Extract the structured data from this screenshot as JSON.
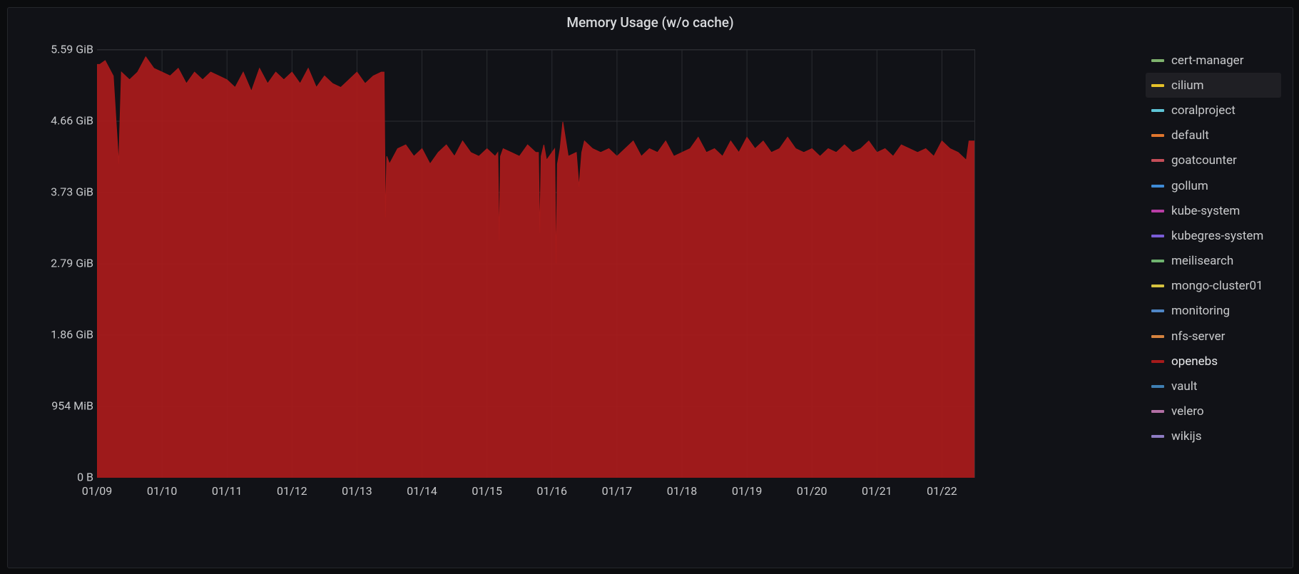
{
  "panel": {
    "title": "Memory Usage (w/o cache)"
  },
  "chart_data": {
    "type": "area",
    "title": "Memory Usage (w/o cache)",
    "xlabel": "",
    "ylabel": "",
    "x_ticks": [
      "01/09",
      "01/10",
      "01/11",
      "01/12",
      "01/13",
      "01/14",
      "01/15",
      "01/16",
      "01/17",
      "01/18",
      "01/19",
      "01/20",
      "01/21",
      "01/22"
    ],
    "y_ticks": [
      "0 B",
      "954 MiB",
      "1.86 GiB",
      "2.79 GiB",
      "3.73 GiB",
      "4.66 GiB",
      "5.59 GiB"
    ],
    "ylim_gib": [
      0,
      5.59
    ],
    "x": [
      "01/09 00",
      "01/09 01",
      "01/09 03",
      "01/09 06",
      "01/09 08",
      "01/09 09",
      "01/09 12",
      "01/09 15",
      "01/09 18",
      "01/09 21",
      "01/10 00",
      "01/10 03",
      "01/10 06",
      "01/10 09",
      "01/10 12",
      "01/10 15",
      "01/10 18",
      "01/10 21",
      "01/11 00",
      "01/11 03",
      "01/11 06",
      "01/11 09",
      "01/11 12",
      "01/11 15",
      "01/11 18",
      "01/11 21",
      "01/12 00",
      "01/12 03",
      "01/12 06",
      "01/12 09",
      "01/12 12",
      "01/12 15",
      "01/12 18",
      "01/12 21",
      "01/13 00",
      "01/13 03",
      "01/13 06",
      "01/13 09",
      "01/13 10",
      "01/13 10.5",
      "01/13 11",
      "01/13 12",
      "01/13 15",
      "01/13 18",
      "01/13 21",
      "01/14 00",
      "01/14 03",
      "01/14 06",
      "01/14 09",
      "01/14 12",
      "01/14 15",
      "01/14 18",
      "01/14 21",
      "01/15 00",
      "01/15 03",
      "01/15 04",
      "01/15 04.5",
      "01/15 05",
      "01/15 06",
      "01/15 09",
      "01/15 12",
      "01/15 15",
      "01/15 18",
      "01/15 19",
      "01/15 19.5",
      "01/15 20",
      "01/15 21",
      "01/15 22",
      "01/16 00",
      "01/16 01",
      "01/16 01.5",
      "01/16 02",
      "01/16 03",
      "01/16 04",
      "01/16 06",
      "01/16 09",
      "01/16 10",
      "01/16 11",
      "01/16 12",
      "01/16 15",
      "01/16 18",
      "01/16 21",
      "01/17 00",
      "01/17 03",
      "01/17 06",
      "01/17 09",
      "01/17 12",
      "01/17 15",
      "01/17 18",
      "01/17 21",
      "01/18 00",
      "01/18 03",
      "01/18 06",
      "01/18 09",
      "01/18 12",
      "01/18 15",
      "01/18 18",
      "01/18 21",
      "01/19 00",
      "01/19 03",
      "01/19 06",
      "01/19 09",
      "01/19 12",
      "01/19 15",
      "01/19 18",
      "01/19 21",
      "01/20 00",
      "01/20 03",
      "01/20 06",
      "01/20 09",
      "01/20 12",
      "01/20 15",
      "01/20 18",
      "01/20 21",
      "01/21 00",
      "01/21 03",
      "01/21 06",
      "01/21 09",
      "01/21 12",
      "01/21 15",
      "01/21 18",
      "01/21 21",
      "01/22 00",
      "01/22 03",
      "01/22 06",
      "01/22 09",
      "01/22 10",
      "01/22 12"
    ],
    "series": [
      {
        "name": "openebs",
        "color": "#a61b1b",
        "values_gib": [
          5.4,
          5.4,
          5.45,
          5.25,
          4.1,
          5.3,
          5.2,
          5.3,
          5.5,
          5.35,
          5.3,
          5.25,
          5.35,
          5.15,
          5.3,
          5.2,
          5.3,
          5.25,
          5.2,
          5.1,
          5.3,
          5.05,
          5.35,
          5.15,
          5.3,
          5.2,
          5.3,
          5.15,
          5.35,
          5.1,
          5.25,
          5.15,
          5.1,
          5.2,
          5.3,
          5.15,
          5.25,
          5.3,
          5.3,
          3.4,
          4.2,
          4.1,
          4.3,
          4.35,
          4.2,
          4.3,
          4.1,
          4.25,
          4.35,
          4.2,
          4.4,
          4.25,
          4.2,
          4.3,
          4.2,
          4.25,
          3.1,
          4.2,
          4.3,
          4.25,
          4.2,
          4.35,
          4.25,
          4.25,
          3.2,
          4.2,
          4.35,
          4.15,
          4.25,
          4.3,
          2.8,
          4.1,
          4.3,
          4.65,
          4.2,
          4.25,
          3.8,
          4.25,
          4.4,
          4.3,
          4.25,
          4.3,
          4.2,
          4.3,
          4.4,
          4.2,
          4.3,
          4.25,
          4.4,
          4.2,
          4.25,
          4.3,
          4.45,
          4.25,
          4.3,
          4.2,
          4.4,
          4.25,
          4.45,
          4.3,
          4.4,
          4.25,
          4.3,
          4.45,
          4.3,
          4.25,
          4.3,
          4.2,
          4.3,
          4.25,
          4.35,
          4.25,
          4.3,
          4.4,
          4.25,
          4.3,
          4.2,
          4.35,
          4.3,
          4.25,
          4.3,
          4.2,
          4.4,
          4.3,
          4.25,
          4.15,
          4.4,
          4.4
        ]
      },
      {
        "name": "cert-manager",
        "color": "#7eb26d"
      },
      {
        "name": "cilium",
        "color": "#e6c229",
        "highlight": true
      },
      {
        "name": "coralproject",
        "color": "#5ec4d6"
      },
      {
        "name": "default",
        "color": "#e0752d"
      },
      {
        "name": "goatcounter",
        "color": "#c44d58"
      },
      {
        "name": "gollum",
        "color": "#3f8bd6"
      },
      {
        "name": "kube-system",
        "color": "#b83da5"
      },
      {
        "name": "kubegres-system",
        "color": "#7a5cd6"
      },
      {
        "name": "meilisearch",
        "color": "#6fb36f"
      },
      {
        "name": "mongo-cluster01",
        "color": "#d6c23f"
      },
      {
        "name": "monitoring",
        "color": "#4f86c6"
      },
      {
        "name": "nfs-server",
        "color": "#d6833f"
      },
      {
        "name": "vault",
        "color": "#3f7fb3"
      },
      {
        "name": "velero",
        "color": "#b36fa5"
      },
      {
        "name": "wikijs",
        "color": "#8e7cc3"
      }
    ],
    "legend_order": [
      "cert-manager",
      "cilium",
      "coralproject",
      "default",
      "goatcounter",
      "gollum",
      "kube-system",
      "kubegres-system",
      "meilisearch",
      "mongo-cluster01",
      "monitoring",
      "nfs-server",
      "openebs",
      "vault",
      "velero",
      "wikijs"
    ]
  }
}
